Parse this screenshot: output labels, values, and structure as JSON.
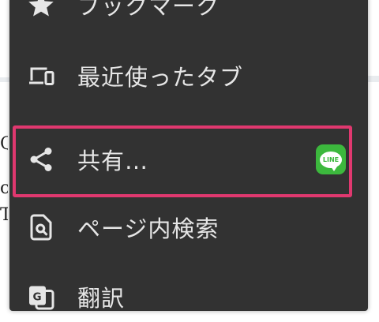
{
  "menu": {
    "items": [
      {
        "label": "ブックマーク",
        "icon": "star-icon"
      },
      {
        "label": "最近使ったタブ",
        "icon": "devices-icon"
      },
      {
        "label": "共有…",
        "icon": "share-icon",
        "badge": "LINE"
      },
      {
        "label": "ページ内検索",
        "icon": "find-in-page-icon"
      },
      {
        "label": "翻訳",
        "icon": "translate-icon"
      }
    ]
  },
  "colors": {
    "menu_background": "#323232",
    "text": "#e6e6e6",
    "highlight_border": "#e0386f",
    "line_green": "#3cb83d"
  }
}
